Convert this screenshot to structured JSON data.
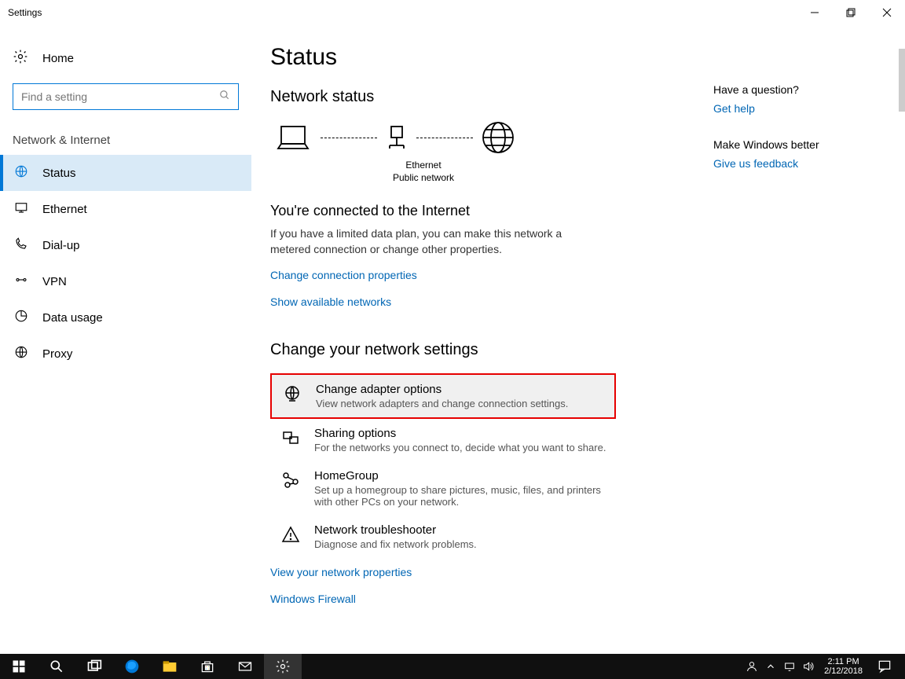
{
  "titlebar": {
    "title": "Settings"
  },
  "sidebar": {
    "home": "Home",
    "search_placeholder": "Find a setting",
    "category": "Network & Internet",
    "items": [
      {
        "label": "Status"
      },
      {
        "label": "Ethernet"
      },
      {
        "label": "Dial-up"
      },
      {
        "label": "VPN"
      },
      {
        "label": "Data usage"
      },
      {
        "label": "Proxy"
      }
    ]
  },
  "main": {
    "page_title": "Status",
    "network_status_heading": "Network status",
    "diagram": {
      "adapter": "Ethernet",
      "network_type": "Public network"
    },
    "connected_heading": "You're connected to the Internet",
    "connected_body": "If you have a limited data plan, you can make this network a metered connection or change other properties.",
    "link_change_conn": "Change connection properties",
    "link_show_networks": "Show available networks",
    "change_settings_heading": "Change your network settings",
    "items": [
      {
        "title": "Change adapter options",
        "desc": "View network adapters and change connection settings."
      },
      {
        "title": "Sharing options",
        "desc": "For the networks you connect to, decide what you want to share."
      },
      {
        "title": "HomeGroup",
        "desc": "Set up a homegroup to share pictures, music, files, and printers with other PCs on your network."
      },
      {
        "title": "Network troubleshooter",
        "desc": "Diagnose and fix network problems."
      }
    ],
    "link_view_props": "View your network properties",
    "link_firewall": "Windows Firewall"
  },
  "rightside": {
    "question": "Have a question?",
    "get_help": "Get help",
    "make_better": "Make Windows better",
    "feedback": "Give us feedback"
  },
  "taskbar": {
    "time": "2:11 PM",
    "date": "2/12/2018"
  }
}
